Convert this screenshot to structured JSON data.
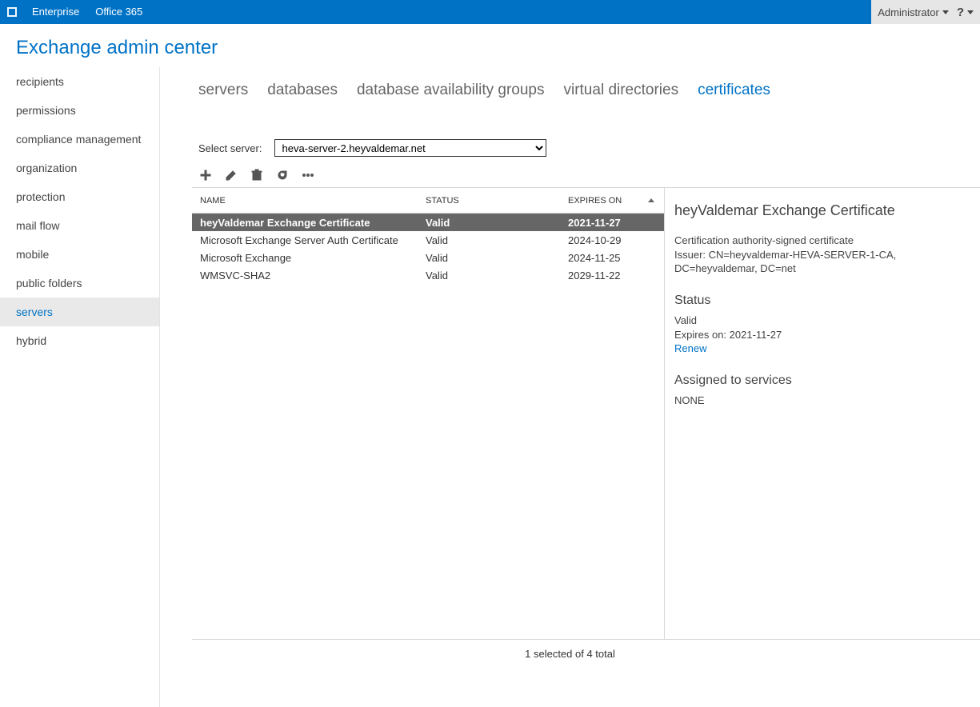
{
  "topbar": {
    "tabs": [
      "Enterprise",
      "Office 365"
    ],
    "user": "Administrator",
    "help": "?"
  },
  "header": {
    "title": "Exchange admin center"
  },
  "sidebar": {
    "items": [
      {
        "label": "recipients"
      },
      {
        "label": "permissions"
      },
      {
        "label": "compliance management"
      },
      {
        "label": "organization"
      },
      {
        "label": "protection"
      },
      {
        "label": "mail flow"
      },
      {
        "label": "mobile"
      },
      {
        "label": "public folders"
      },
      {
        "label": "servers",
        "selected": true
      },
      {
        "label": "hybrid"
      }
    ]
  },
  "tabs": {
    "items": [
      {
        "label": "servers"
      },
      {
        "label": "databases"
      },
      {
        "label": "database availability groups"
      },
      {
        "label": "virtual directories"
      },
      {
        "label": "certificates",
        "active": true
      }
    ]
  },
  "serverSelect": {
    "label": "Select server:",
    "value": "heva-server-2.heyvaldemar.net"
  },
  "grid": {
    "columns": {
      "name": "NAME",
      "status": "STATUS",
      "expires": "EXPIRES ON"
    },
    "rows": [
      {
        "name": "heyValdemar Exchange Certificate",
        "status": "Valid",
        "expires": "2021-11-27",
        "selected": true
      },
      {
        "name": "Microsoft Exchange Server Auth Certificate",
        "status": "Valid",
        "expires": "2024-10-29"
      },
      {
        "name": "Microsoft Exchange",
        "status": "Valid",
        "expires": "2024-11-25"
      },
      {
        "name": "WMSVC-SHA2",
        "status": "Valid",
        "expires": "2029-11-22"
      }
    ]
  },
  "detail": {
    "title": "heyValdemar Exchange Certificate",
    "type": "Certification authority-signed certificate",
    "issuer": "Issuer: CN=heyvaldemar-HEVA-SERVER-1-CA, DC=heyvaldemar, DC=net",
    "statusHeading": "Status",
    "statusValue": "Valid",
    "expiresOn": "Expires on: 2021-11-27",
    "renew": "Renew",
    "assignedHeading": "Assigned to services",
    "assignedValue": "NONE"
  },
  "footer": {
    "status": "1 selected of 4 total"
  }
}
